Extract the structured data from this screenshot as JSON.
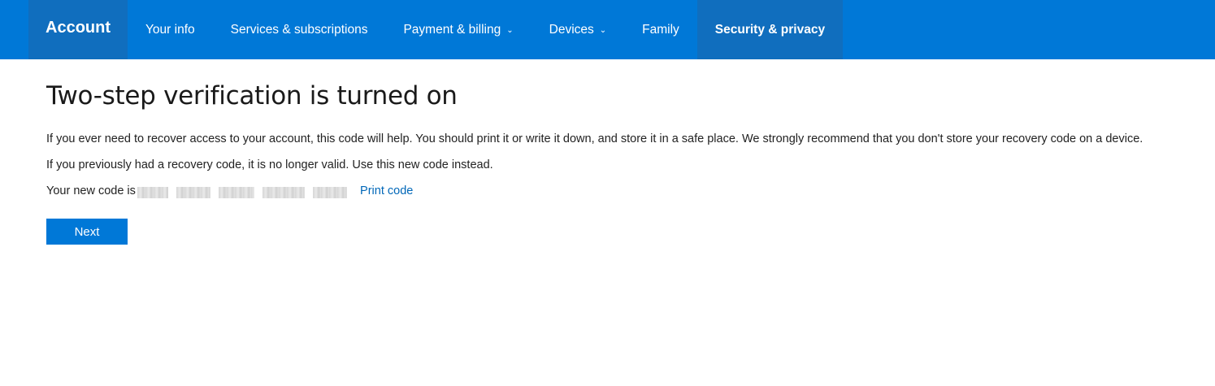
{
  "header": {
    "brand": "Account",
    "nav_items": [
      {
        "label": "Your info"
      },
      {
        "label": "Services & subscriptions"
      },
      {
        "label": "Payment & billing",
        "chevron": "⌄"
      },
      {
        "label": "Devices",
        "chevron": "⌄"
      },
      {
        "label": "Family"
      },
      {
        "label": "Security & privacy"
      }
    ],
    "active_item": "Security & privacy",
    "colors": {
      "bar": "#0078d7",
      "active": "#106ebe"
    }
  },
  "main": {
    "title": "Two-step verification is turned on",
    "paragraph_1": "If you ever need to recover access to your account, this code will help. You should print it or write it down, and store it in a safe place. We strongly recommend that you don't store your recovery code on a device.",
    "paragraph_2": "If you previously had a recovery code, it is no longer valid. Use this new code instead.",
    "code_label": "Your new code is",
    "print_link": "Print code",
    "next_button": "Next"
  }
}
